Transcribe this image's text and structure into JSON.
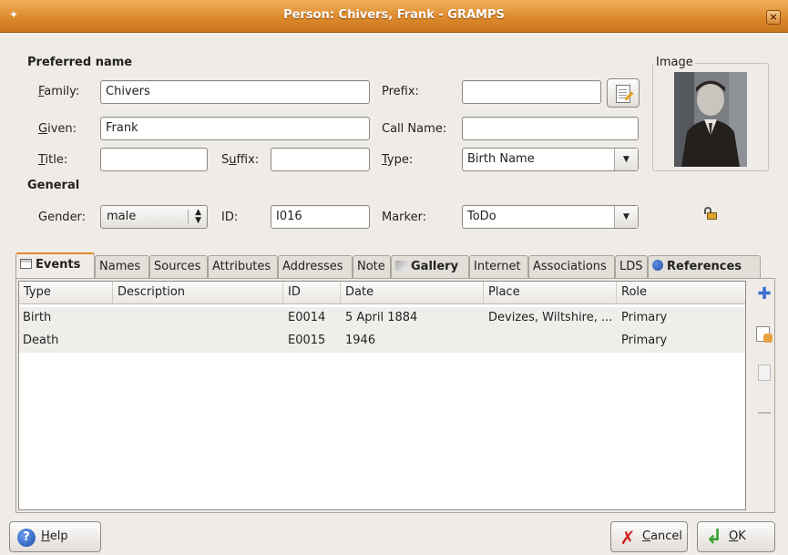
{
  "window": {
    "title": "Person: Chivers, Frank - GRAMPS",
    "close_label": "×"
  },
  "preferred_name": {
    "heading": "Preferred name",
    "family_label_u": "F",
    "family_label_rest": "amily:",
    "family_value": "Chivers",
    "prefix_label": "Prefix:",
    "prefix_value": "",
    "given_label_u": "G",
    "given_label_rest": "iven:",
    "given_value": "Frank",
    "call_name_label": "Call Name:",
    "call_name_value": "",
    "title_label_u": "T",
    "title_label_rest": "itle:",
    "title_value": "",
    "suffix_label_a": "S",
    "suffix_label_u": "u",
    "suffix_label_rest": "ffix:",
    "suffix_value": "",
    "type_label_u": "T",
    "type_label_rest": "ype:",
    "type_value": "Birth Name"
  },
  "image": {
    "legend": "Image"
  },
  "general": {
    "heading": "General",
    "gender_label": "Gender:",
    "gender_value": "male",
    "id_label": "ID:",
    "id_value": "I016",
    "marker_label": "Marker:",
    "marker_value": "ToDo"
  },
  "tabs": [
    {
      "label": "Events",
      "active": true
    },
    {
      "label": "Names"
    },
    {
      "label": "Sources"
    },
    {
      "label": "Attributes"
    },
    {
      "label": "Addresses"
    },
    {
      "label": "Note"
    },
    {
      "label": "Gallery"
    },
    {
      "label": "Internet"
    },
    {
      "label": "Associations"
    },
    {
      "label": "LDS"
    },
    {
      "label": "References"
    }
  ],
  "events": {
    "columns": [
      "Type",
      "Description",
      "ID",
      "Date",
      "Place",
      "Role"
    ],
    "rows": [
      {
        "type": "Birth",
        "description": "",
        "id": "E0014",
        "date": "5 April 1884",
        "place": "Devizes, Wiltshire, ...",
        "role": "Primary"
      },
      {
        "type": "Death",
        "description": "",
        "id": "E0015",
        "date": "1946",
        "place": "",
        "role": "Primary"
      }
    ]
  },
  "buttons": {
    "help_u": "H",
    "help_rest": "elp",
    "cancel_u": "C",
    "cancel_rest": "ancel",
    "ok_u": "O",
    "ok_rest": "K"
  },
  "colors": {
    "accent": "#e28a2a",
    "titlebar": "#dd8a2c"
  }
}
